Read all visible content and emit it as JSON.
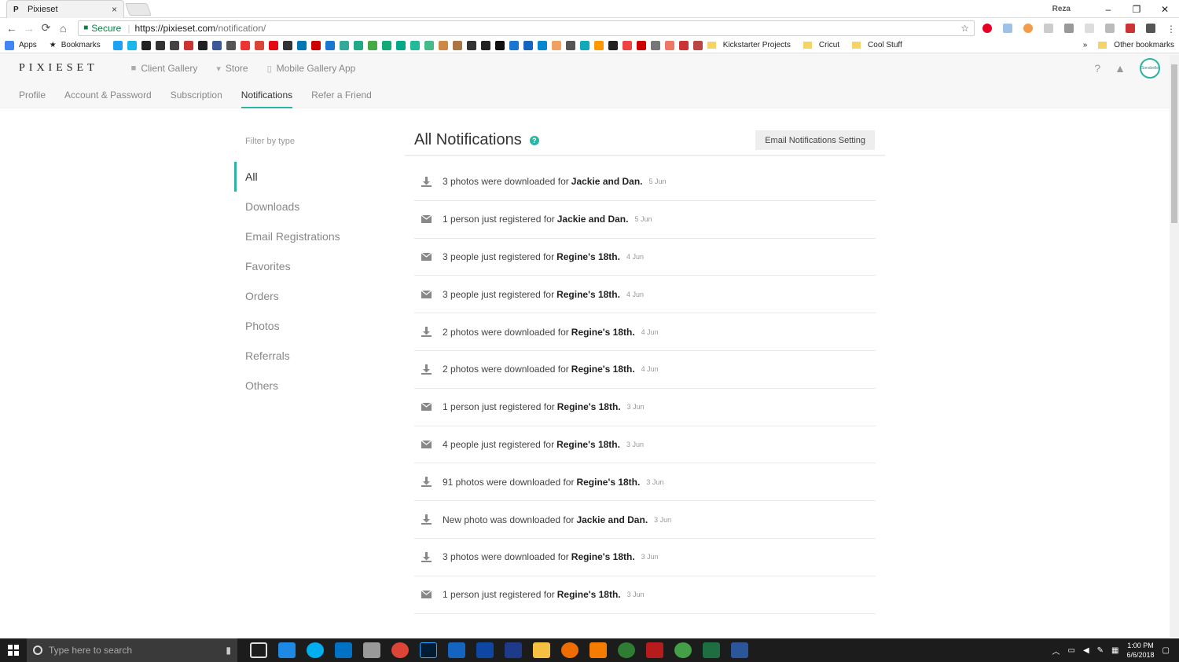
{
  "browser": {
    "tab_title": "Pixieset",
    "tab_favicon": "P",
    "close_tab": "×",
    "user": "Reza",
    "secure_label": "Secure",
    "url_host": "https://pixieset.com",
    "url_path": "/notification/",
    "nav_back": "←",
    "nav_forward": "→",
    "nav_reload": "⟳",
    "nav_home": "⌂",
    "bookmark_star": "☆",
    "win_min": "–",
    "win_max": "❐",
    "win_close": "✕"
  },
  "bookmarks": {
    "apps": "Apps",
    "bookmarks": "Bookmarks",
    "kickstarter": "Kickstarter Projects",
    "cricut": "Cricut",
    "cool_stuff": "Cool Stuff",
    "more": "»",
    "other": "Other bookmarks"
  },
  "header": {
    "logo": "PIXIESET",
    "nav": [
      {
        "label": "Client Gallery",
        "icon": "camera-icon"
      },
      {
        "label": "Store",
        "icon": "cart-icon"
      },
      {
        "label": "Mobile Gallery App",
        "icon": "phone-icon"
      }
    ],
    "help": "?",
    "bell": "🔔",
    "avatar": "Sonsbelle"
  },
  "subnav": {
    "items": [
      "Profile",
      "Account & Password",
      "Subscription",
      "Notifications",
      "Refer a Friend"
    ],
    "active_index": 3
  },
  "filter": {
    "title": "Filter by type",
    "items": [
      "All",
      "Downloads",
      "Email Registrations",
      "Favorites",
      "Orders",
      "Photos",
      "Referrals",
      "Others"
    ],
    "active_index": 0
  },
  "notifications": {
    "title": "All Notifications",
    "help_icon": "?",
    "email_button": "Email Notifications Setting",
    "items": [
      {
        "type": "download",
        "text": "3 photos were downloaded for",
        "gallery": "Jackie and Dan.",
        "date": "5 Jun"
      },
      {
        "type": "email",
        "text": "1 person just registered for",
        "gallery": "Jackie and Dan.",
        "date": "5 Jun"
      },
      {
        "type": "email",
        "text": "3 people just registered for",
        "gallery": "Regine's 18th.",
        "date": "4 Jun"
      },
      {
        "type": "email",
        "text": "3 people just registered for",
        "gallery": "Regine's 18th.",
        "date": "4 Jun"
      },
      {
        "type": "download",
        "text": "2 photos were downloaded for",
        "gallery": "Regine's 18th.",
        "date": "4 Jun"
      },
      {
        "type": "download",
        "text": "2 photos were downloaded for",
        "gallery": "Regine's 18th.",
        "date": "4 Jun"
      },
      {
        "type": "email",
        "text": "1 person just registered for",
        "gallery": "Regine's 18th.",
        "date": "3 Jun"
      },
      {
        "type": "email",
        "text": "4 people just registered for",
        "gallery": "Regine's 18th.",
        "date": "3 Jun"
      },
      {
        "type": "download",
        "text": "91 photos were downloaded for",
        "gallery": "Regine's 18th.",
        "date": "3 Jun"
      },
      {
        "type": "download",
        "text": "New photo was downloaded for",
        "gallery": "Jackie and Dan.",
        "date": "3 Jun"
      },
      {
        "type": "download",
        "text": "3 photos were downloaded for",
        "gallery": "Regine's 18th.",
        "date": "3 Jun"
      },
      {
        "type": "email",
        "text": "1 person just registered for",
        "gallery": "Regine's 18th.",
        "date": "3 Jun"
      }
    ]
  },
  "taskbar": {
    "search_placeholder": "Type here to search",
    "time": "1:00 PM",
    "date": "6/6/2018"
  },
  "colors": {
    "accent": "#2bb3a5"
  }
}
